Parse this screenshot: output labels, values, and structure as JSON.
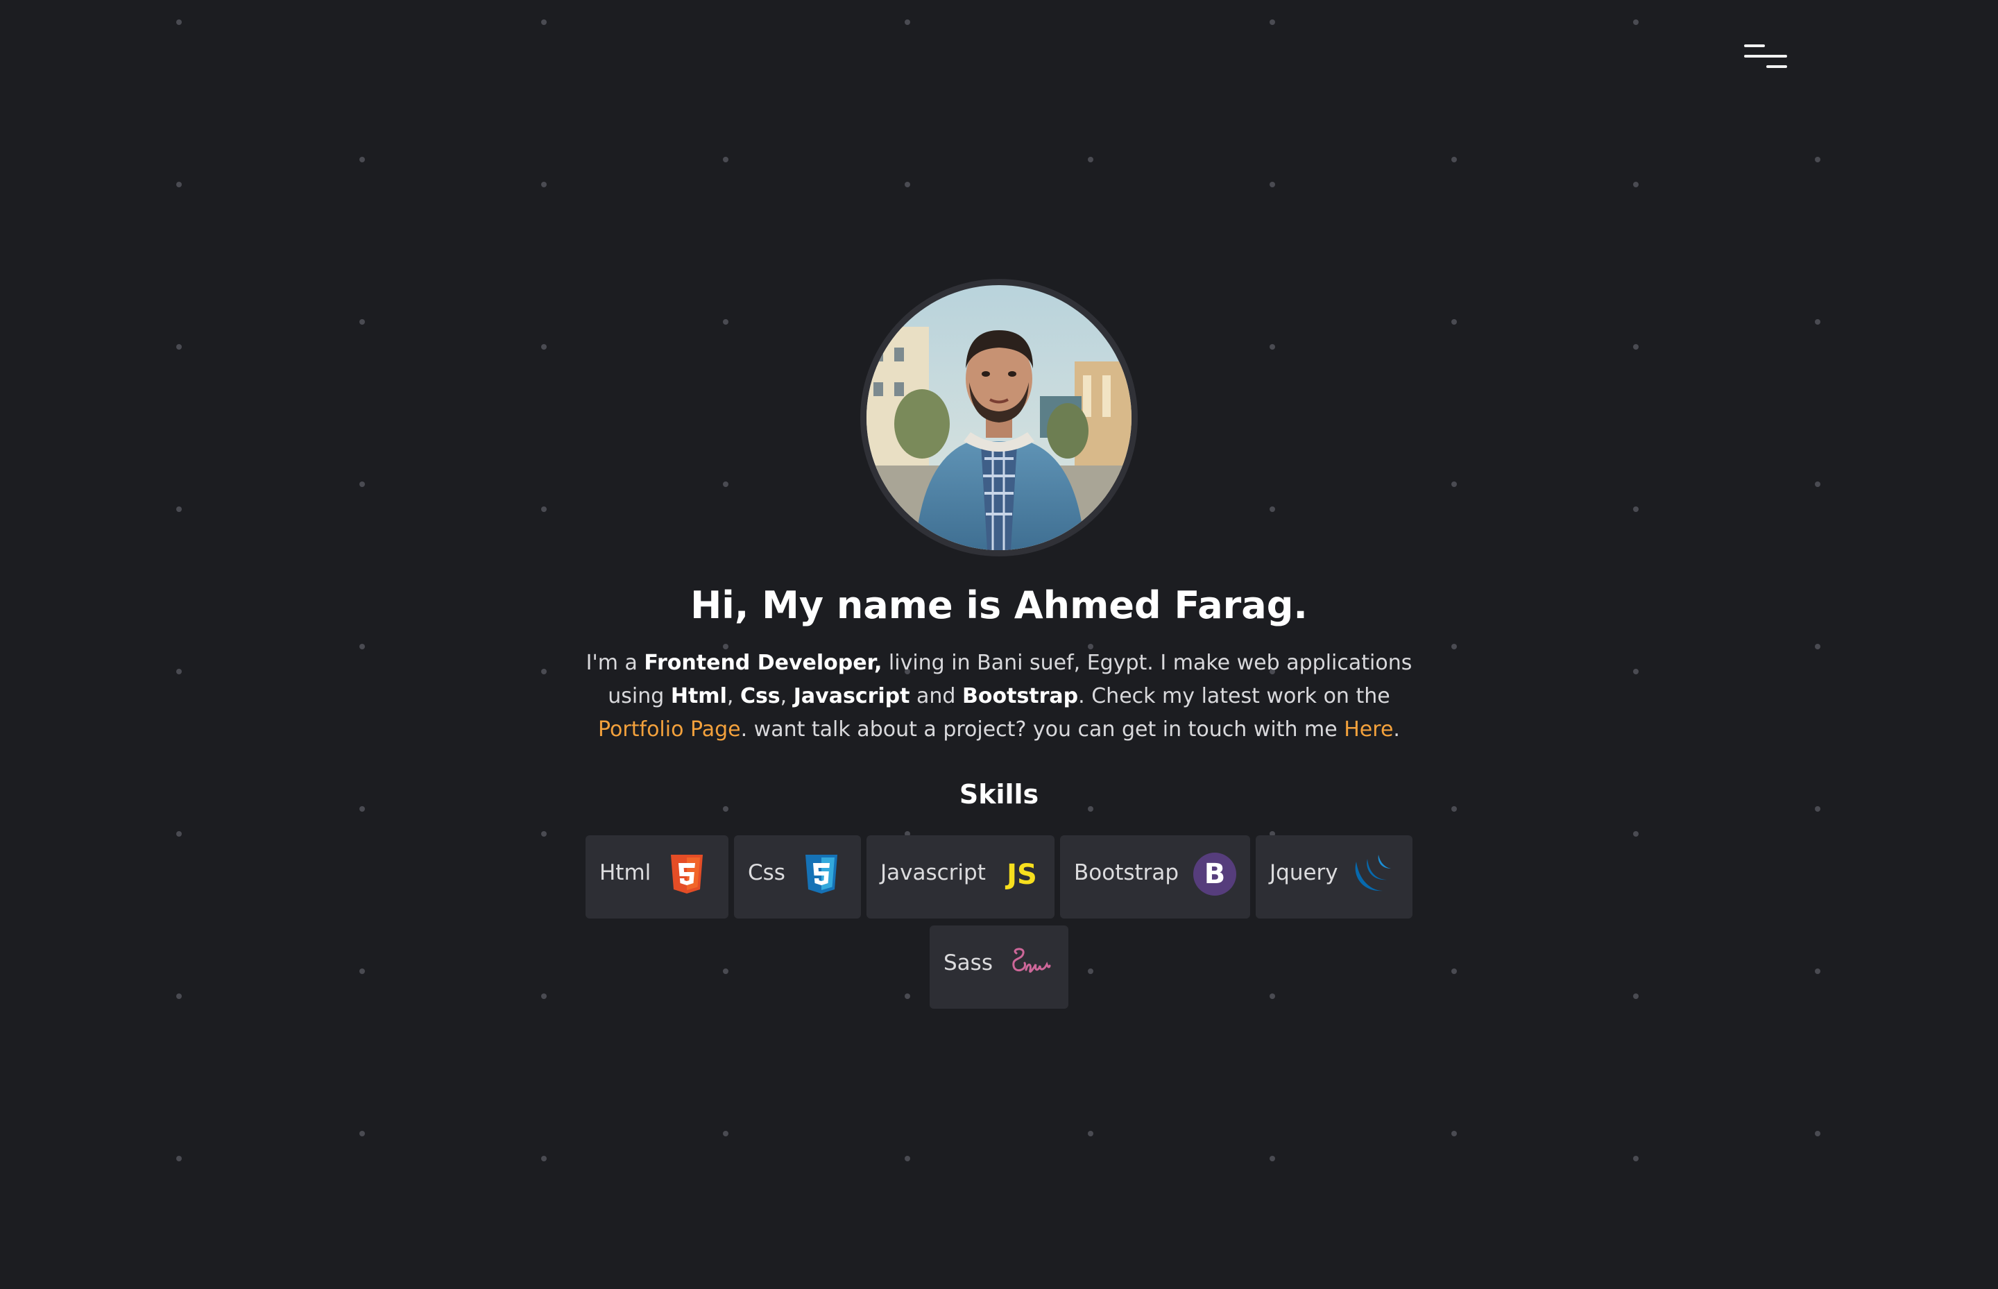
{
  "header": {
    "menu_icon": "hamburger-menu-icon"
  },
  "profile": {
    "photo": "profile-photo"
  },
  "hero": {
    "title": "Hi, My name is Ahmed Farag.",
    "intro": {
      "p1": "I'm a ",
      "role": "Frontend Developer,",
      "p2": " living in Bani suef, Egypt. I make web applications using ",
      "tech1": "Html",
      "sep1": ", ",
      "tech2": "Css",
      "sep2": ", ",
      "tech3": "Javascript",
      "p3": " and ",
      "tech4": "Bootstrap",
      "p4": ". Check my latest work on the ",
      "portfolio_link": "Portfolio Page",
      "p5": ". want talk about a project? you can get in touch with me ",
      "here_link": "Here",
      "p6": "."
    }
  },
  "skills": {
    "title": "Skills",
    "items": [
      {
        "label": "Html",
        "icon": "html5-icon",
        "color": "#e44d26"
      },
      {
        "label": "Css",
        "icon": "css3-icon",
        "color": "#1572b6"
      },
      {
        "label": "Javascript",
        "icon": "javascript-icon",
        "color": "#f7df1e"
      },
      {
        "label": "Bootstrap",
        "icon": "bootstrap-icon",
        "color": "#563d7c"
      },
      {
        "label": "Jquery",
        "icon": "jquery-icon",
        "color": "#0769ad"
      },
      {
        "label": "Sass",
        "icon": "sass-icon",
        "color": "#cd6799"
      }
    ]
  },
  "colors": {
    "background": "#1c1d21",
    "card": "#2d2e34",
    "accent": "#f3a13c"
  }
}
